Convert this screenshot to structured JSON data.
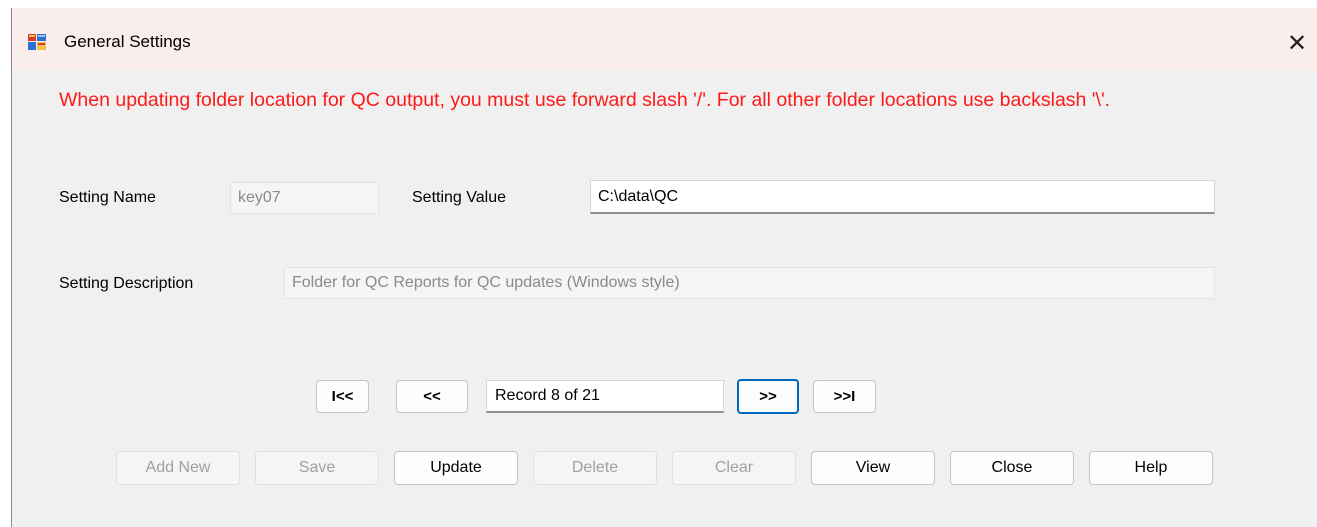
{
  "window": {
    "title": "General Settings",
    "close_glyph": "✕",
    "icon": "app-window-icon"
  },
  "warning": "When updating folder location for QC output, you must use forward slash '/'. For all other folder locations use backslash '\\'.",
  "form": {
    "setting_name_label": "Setting Name",
    "setting_name_value": "key07",
    "setting_value_label": "Setting Value",
    "setting_value_value": "C:\\data\\QC",
    "setting_description_label": "Setting Description",
    "setting_description_value": "Folder for QC Reports for QC updates (Windows style)"
  },
  "navigation": {
    "first": "I<<",
    "prev": "<<",
    "record": "Record 8 of 21",
    "next": ">>",
    "last": ">>I"
  },
  "actions": {
    "add_new": "Add New",
    "save": "Save",
    "update": "Update",
    "delete": "Delete",
    "clear": "Clear",
    "view": "View",
    "close": "Close",
    "help": "Help"
  },
  "colors": {
    "warning": "#ff1a1a",
    "titlebar": "#f9eeeb",
    "focus": "#0067c0"
  }
}
